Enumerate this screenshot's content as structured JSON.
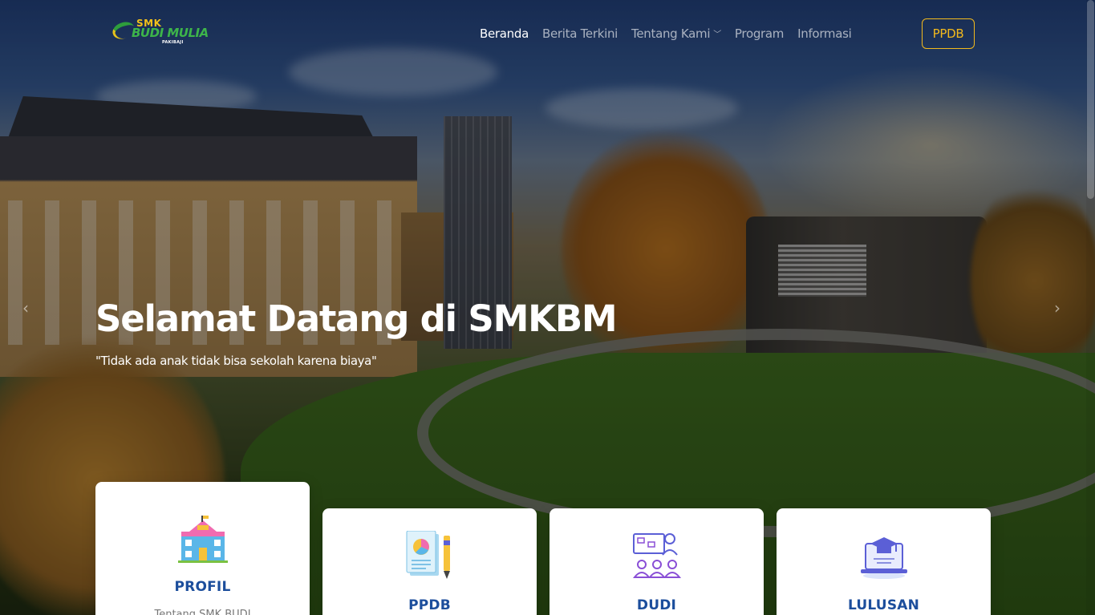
{
  "header": {
    "logo": {
      "line1": "SMK",
      "line2": "BUDI MULIA",
      "line3": "PAKIBAJI"
    },
    "nav": [
      {
        "label": "Beranda",
        "active": true
      },
      {
        "label": "Berita Terkini",
        "active": false
      },
      {
        "label": "Tentang Kami",
        "active": false,
        "dropdown": true
      },
      {
        "label": "Program",
        "active": false
      },
      {
        "label": "Informasi",
        "active": false
      }
    ],
    "cta_label": "PPDB",
    "colors": {
      "cta": "#f2b91d",
      "nav_active": "#ffffff"
    }
  },
  "hero": {
    "title": "Selamat Datang di SMKBM",
    "subtitle": "\"Tidak ada anak tidak bisa sekolah karena biaya\""
  },
  "carousel": {
    "prev_icon": "chevron-left-icon",
    "next_icon": "chevron-right-icon"
  },
  "cards": [
    {
      "title": "PROFIL",
      "desc": "Tentang SMK BUDI",
      "icon": "school-building-icon"
    },
    {
      "title": "PPDB",
      "icon": "document-pen-icon"
    },
    {
      "title": "DUDI",
      "icon": "presentation-group-icon"
    },
    {
      "title": "LULUSAN",
      "icon": "graduation-laptop-icon"
    }
  ],
  "colors": {
    "card_title": "#1c4e9c"
  }
}
